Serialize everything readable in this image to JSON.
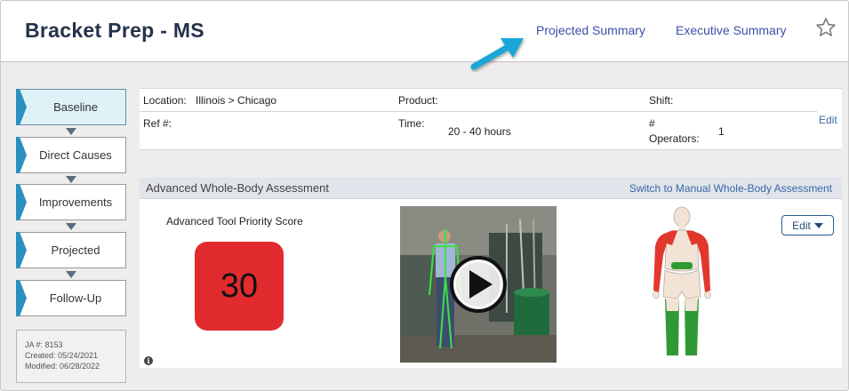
{
  "header": {
    "title": "Bracket Prep - MS",
    "links": [
      "Projected Summary",
      "Executive Summary"
    ]
  },
  "sidebar": {
    "steps": [
      {
        "label": "Baseline",
        "active": true
      },
      {
        "label": "Direct Causes",
        "active": false
      },
      {
        "label": "Improvements",
        "active": false
      },
      {
        "label": "Projected",
        "active": false
      },
      {
        "label": "Follow-Up",
        "active": false
      }
    ],
    "meta": {
      "ja": "JA #: 8153",
      "created": "Created: 05/24/2021",
      "modified": "Modified: 06/28/2022"
    }
  },
  "info": {
    "location_label": "Location:",
    "location_value": "Illinois > Chicago",
    "product_label": "Product:",
    "shift_label": "Shift:",
    "ref_label": "Ref #:",
    "time_label": "Time:",
    "time_value": "20 - 40 hours",
    "operators_label_1": "#",
    "operators_label_2": "Operators:",
    "operators_value": "1",
    "edit": "Edit"
  },
  "assessment": {
    "title": "Advanced Whole-Body Assessment",
    "switch_link": "Switch to Manual Whole-Body Assessment",
    "score_label": "Advanced Tool Priority Score",
    "score": "30",
    "edit_button": "Edit"
  },
  "colors": {
    "score_red": "#e22b2e",
    "link_blue": "#3a4fa8",
    "active_step": "#dff2f8",
    "risk_red": "#e2372d",
    "risk_green": "#2f9a33"
  }
}
